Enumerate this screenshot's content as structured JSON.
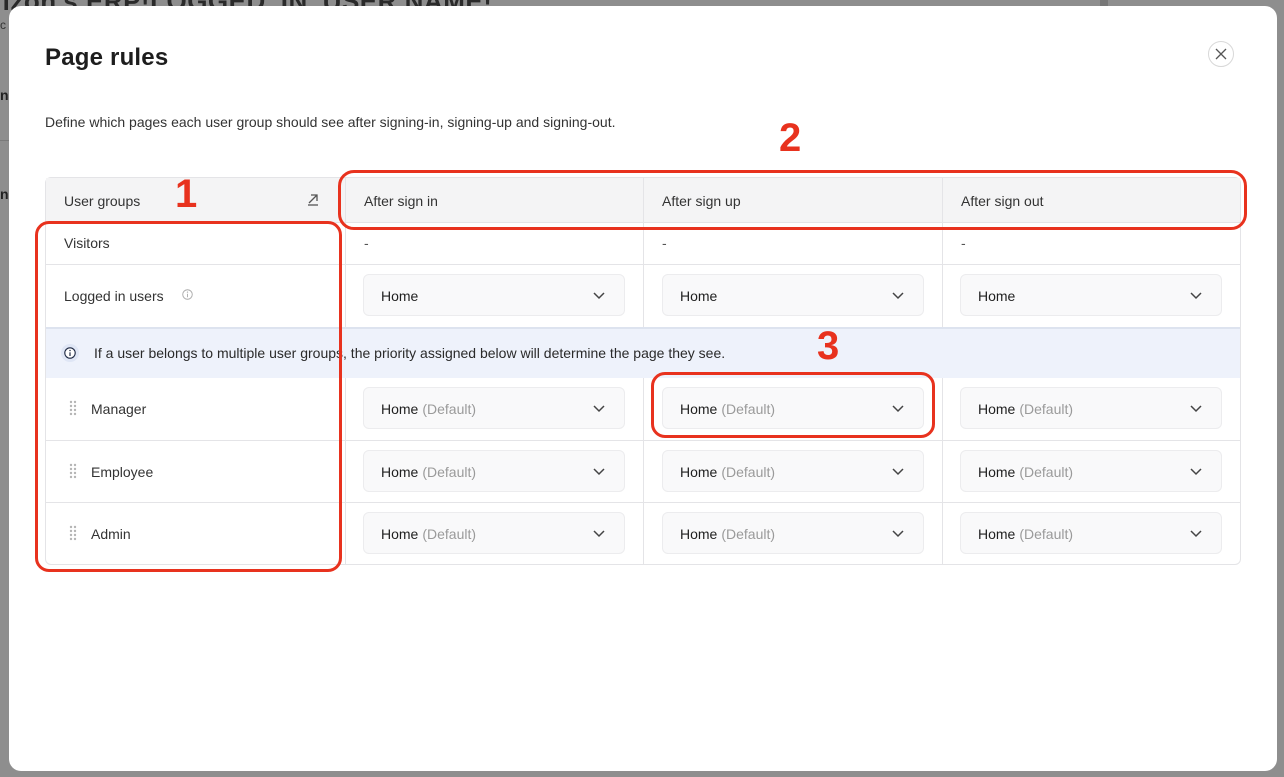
{
  "backdrop": {
    "title": "rizon's ERP!LOGGED_IN_USER.NAME!",
    "line1": "c",
    "line2": "na",
    "line3": "n"
  },
  "modal": {
    "title": "Page rules",
    "description": "Define which pages each user group should see after signing-in, signing-up and signing-out.",
    "close_icon": "close-icon"
  },
  "table": {
    "headers": {
      "user_groups": "User groups",
      "after_sign_in": "After sign in",
      "after_sign_up": "After sign up",
      "after_sign_out": "After sign out"
    },
    "visitors": {
      "label": "Visitors",
      "sign_in": "-",
      "sign_up": "-",
      "sign_out": "-"
    },
    "logged_in": {
      "label": "Logged in users",
      "sign_in": "Home",
      "sign_up": "Home",
      "sign_out": "Home"
    },
    "info_text": "If a user belongs to multiple user groups, the priority assigned below will determine the page they see.",
    "default_tag": "(Default)",
    "groups": [
      {
        "label": "Manager",
        "sign_in": "Home",
        "sign_up": "Home",
        "sign_out": "Home"
      },
      {
        "label": "Employee",
        "sign_in": "Home",
        "sign_up": "Home",
        "sign_out": "Home"
      },
      {
        "label": "Admin",
        "sign_in": "Home",
        "sign_up": "Home",
        "sign_out": "Home"
      }
    ]
  },
  "annotations": {
    "one": "1",
    "two": "2",
    "three": "3",
    "color": "#e8321e"
  }
}
